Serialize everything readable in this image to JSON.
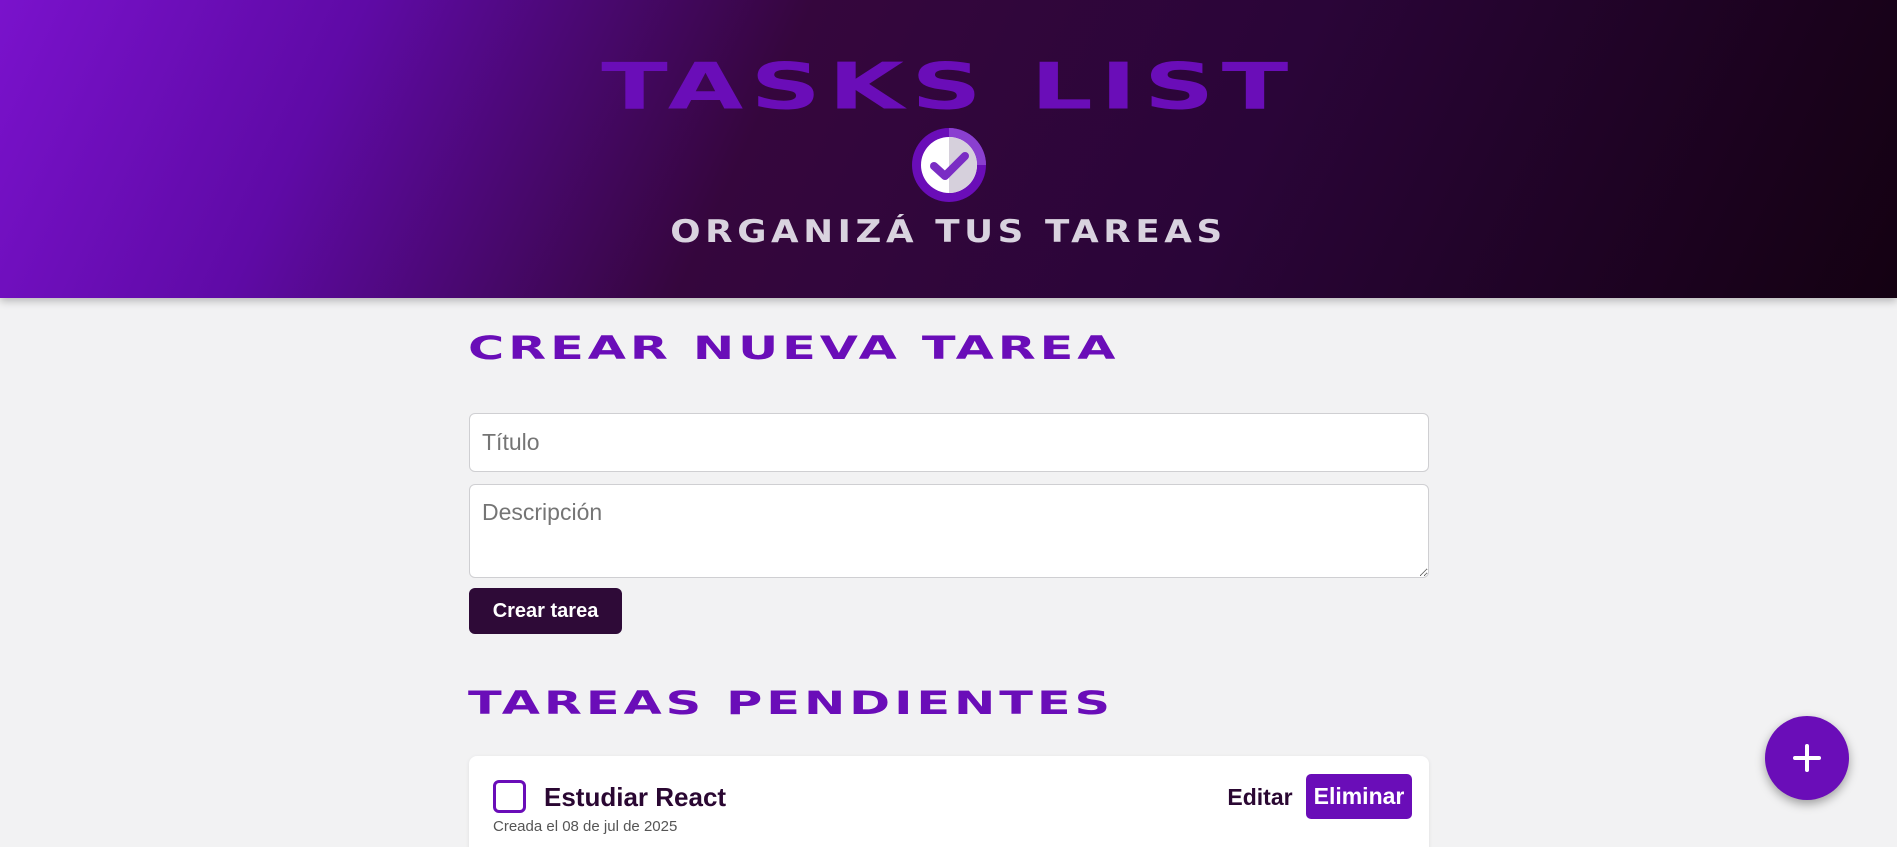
{
  "header": {
    "title": "TASKS LIST",
    "subtitle": "ORGANIZÁ TUS TAREAS",
    "logo_icon": "check-circle-icon"
  },
  "create_section": {
    "heading": "CREAR NUEVA TAREA",
    "title_input": {
      "value": "",
      "placeholder": "Título"
    },
    "description_input": {
      "value": "",
      "placeholder": "Descripción"
    },
    "submit_label": "Crear tarea"
  },
  "pending_section": {
    "heading": "TAREAS PENDIENTES",
    "tasks": [
      {
        "title": "Estudiar React",
        "created": "Creada el 08 de jul de 2025",
        "completed": false,
        "edit_label": "Editar",
        "delete_label": "Eliminar"
      }
    ]
  },
  "fab": {
    "icon": "plus-icon"
  },
  "colors": {
    "accent": "#6a0db8",
    "dark": "#2e0a37",
    "background": "#f2f2f3"
  }
}
